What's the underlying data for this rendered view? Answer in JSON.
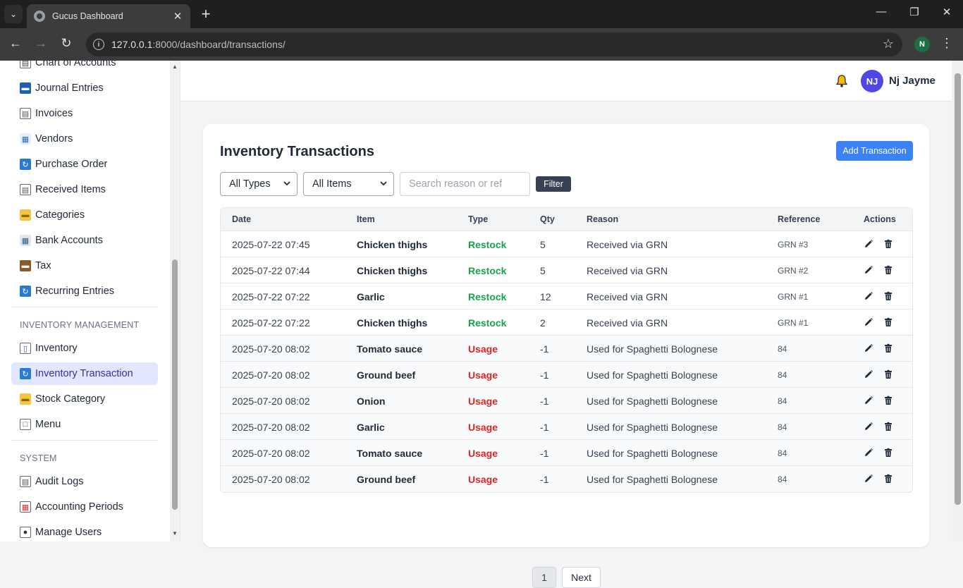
{
  "browser": {
    "tab_title": "Gucus Dashboard",
    "url_host": "127.0.0.1",
    "url_path": ":8000/dashboard/transactions/",
    "profile_initial": "N"
  },
  "sidebar": {
    "items_top": [
      {
        "label": "Chart of Accounts",
        "icon": "ledger-icon"
      },
      {
        "label": "Journal Entries",
        "icon": "book-icon"
      },
      {
        "label": "Invoices",
        "icon": "document-icon"
      },
      {
        "label": "Vendors",
        "icon": "building-icon"
      },
      {
        "label": "Purchase Order",
        "icon": "repeat-icon"
      },
      {
        "label": "Received Items",
        "icon": "document-icon"
      },
      {
        "label": "Categories",
        "icon": "folder-icon"
      },
      {
        "label": "Bank Accounts",
        "icon": "bank-icon"
      },
      {
        "label": "Tax",
        "icon": "briefcase-icon"
      },
      {
        "label": "Recurring Entries",
        "icon": "repeat-icon"
      }
    ],
    "section_inventory": "INVENTORY MANAGEMENT",
    "items_inventory": [
      {
        "label": "Inventory",
        "icon": "bar-chart-icon"
      },
      {
        "label": "Inventory Transaction",
        "icon": "refresh-icon",
        "active": true
      },
      {
        "label": "Stock Category",
        "icon": "folder-icon"
      },
      {
        "label": "Menu",
        "icon": "menu-frame-icon"
      }
    ],
    "section_system": "SYSTEM",
    "items_system": [
      {
        "label": "Audit Logs",
        "icon": "document-icon"
      },
      {
        "label": "Accounting Periods",
        "icon": "calendar-icon"
      },
      {
        "label": "Manage Users",
        "icon": "user-icon"
      }
    ]
  },
  "header": {
    "avatar_initials": "NJ",
    "user_name": "Nj Jayme"
  },
  "main": {
    "title": "Inventory Transactions",
    "add_button": "Add Transaction",
    "filters": {
      "type_value": "All Types",
      "item_value": "All Items",
      "search_placeholder": "Search reason or ref",
      "filter_button": "Filter"
    },
    "columns": [
      "Date",
      "Item",
      "Type",
      "Qty",
      "Reason",
      "Reference",
      "Actions"
    ],
    "rows": [
      {
        "date": "2025-07-22 07:45",
        "item": "Chicken thighs",
        "type": "Restock",
        "qty": "5",
        "reason": "Received via GRN",
        "reference": "GRN #3"
      },
      {
        "date": "2025-07-22 07:44",
        "item": "Chicken thighs",
        "type": "Restock",
        "qty": "5",
        "reason": "Received via GRN",
        "reference": "GRN #2"
      },
      {
        "date": "2025-07-22 07:22",
        "item": "Garlic",
        "type": "Restock",
        "qty": "12",
        "reason": "Received via GRN",
        "reference": "GRN #1"
      },
      {
        "date": "2025-07-22 07:22",
        "item": "Chicken thighs",
        "type": "Restock",
        "qty": "2",
        "reason": "Received via GRN",
        "reference": "GRN #1"
      },
      {
        "date": "2025-07-20 08:02",
        "item": "Tomato sauce",
        "type": "Usage",
        "qty": "-1",
        "reason": "Used for Spaghetti Bolognese",
        "reference": "84"
      },
      {
        "date": "2025-07-20 08:02",
        "item": "Ground beef",
        "type": "Usage",
        "qty": "-1",
        "reason": "Used for Spaghetti Bolognese",
        "reference": "84"
      },
      {
        "date": "2025-07-20 08:02",
        "item": "Onion",
        "type": "Usage",
        "qty": "-1",
        "reason": "Used for Spaghetti Bolognese",
        "reference": "84"
      },
      {
        "date": "2025-07-20 08:02",
        "item": "Garlic",
        "type": "Usage",
        "qty": "-1",
        "reason": "Used for Spaghetti Bolognese",
        "reference": "84"
      },
      {
        "date": "2025-07-20 08:02",
        "item": "Tomato sauce",
        "type": "Usage",
        "qty": "-1",
        "reason": "Used for Spaghetti Bolognese",
        "reference": "84"
      },
      {
        "date": "2025-07-20 08:02",
        "item": "Ground beef",
        "type": "Usage",
        "qty": "-1",
        "reason": "Used for Spaghetti Bolognese",
        "reference": "84"
      }
    ],
    "pagination": {
      "current": "1",
      "next": "Next"
    }
  },
  "colors": {
    "accent": "#3b82f6",
    "restock": "#16a34a",
    "usage": "#dc2626",
    "active_nav_bg": "#e0e7ff",
    "avatar_bg": "#4f46e5"
  }
}
